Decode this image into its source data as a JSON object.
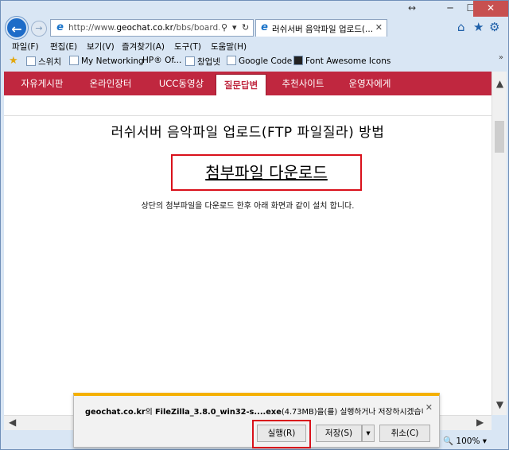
{
  "browser": {
    "caption": {
      "resize_icon": "↔",
      "minimize": "─",
      "maximize": "☐",
      "close": "✕"
    },
    "address": {
      "url_prefix": "http://www.",
      "url_domain": "geochat.co.kr",
      "url_rest": "/bbs/board.php",
      "search": "⚲",
      "dropdown": "▾",
      "refresh": "↻"
    },
    "tab": {
      "title": "러쉬서버 음악파일 업로드(...",
      "close": "✕"
    },
    "icons": {
      "back": "←",
      "forward": "→",
      "home": "⌂",
      "favorites": "★",
      "tools": "⚙",
      "ie": "e"
    },
    "menu": [
      "파일(F)",
      "편집(E)",
      "보기(V)",
      "즐겨찾기(A)",
      "도구(T)",
      "도움말(H)"
    ],
    "favorites": [
      "스위치",
      "My Networking",
      "HP® Of...",
      "창업넷",
      "Google Code",
      "Font Awesome Icons"
    ],
    "favorites_more": "»",
    "zoom": "100%"
  },
  "site": {
    "nav": [
      "자유게시판",
      "온라인장터",
      "UCC동영상",
      "질문답변",
      "추천사이트",
      "운영자에게"
    ],
    "active_nav": "질문답변"
  },
  "post": {
    "title": "러쉬서버 음악파일 업로드(FTP 파일질라) 방법",
    "download_link": "첨부파일 다운로드",
    "description": "상단의 첨부파일을 다운로드 한후 아래 화면과 같이 설치 합니다."
  },
  "download_bar": {
    "site": "geochat.co.kr",
    "particle": "의",
    "filename": "FileZilla_3.8.0_win32-s....exe",
    "size": "(4.73MB)",
    "question": "을(를) 실행하거나 저장하시겠습니까?",
    "run": "실행(R)",
    "save": "저장(S)",
    "save_menu": "▾",
    "cancel": "취소(C)",
    "close": "✕"
  },
  "scroll": {
    "up": "▲",
    "down": "▼",
    "left": "◀",
    "right": "▶"
  },
  "colors": {
    "site_nav": "#c0273f",
    "highlight": "#d9111b",
    "notify_accent": "#f4b000"
  }
}
